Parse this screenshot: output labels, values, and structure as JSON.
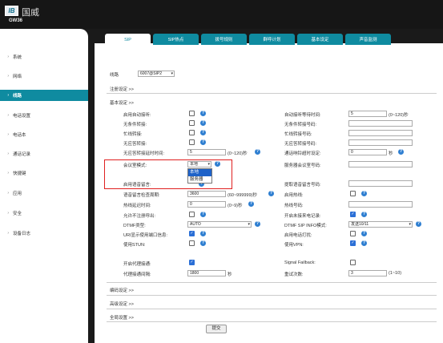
{
  "brand": {
    "logo_text": "IB",
    "name_cn": "国威",
    "model": "GW36"
  },
  "sidebar": {
    "items": [
      {
        "label": "系统"
      },
      {
        "label": "网络"
      },
      {
        "label": "线路"
      },
      {
        "label": "电话设置"
      },
      {
        "label": "电话本"
      },
      {
        "label": "通话记录"
      },
      {
        "label": "快捷键"
      },
      {
        "label": "应用"
      },
      {
        "label": "安全"
      },
      {
        "label": "设备日志"
      }
    ]
  },
  "tabs": [
    {
      "label": "SIP"
    },
    {
      "label": "SIP热点"
    },
    {
      "label": "拨号规则"
    },
    {
      "label": "群呼计划"
    },
    {
      "label": "基本设定"
    },
    {
      "label": "声音监测"
    }
  ],
  "line": {
    "label": "线路",
    "value": "6007@SIP2"
  },
  "sections": {
    "register": "注册设定 >>",
    "basic": "基本设定 >>",
    "codec": "编码设定 >>",
    "advanced": "高级设定 >>",
    "global": "全局设置 >>"
  },
  "fields": {
    "auto_answer": "启用自动接听:",
    "no_answer_fwd": "无条件转接:",
    "busy_fwd": "忙线转接:",
    "noanswer_fwd": "无应答转接:",
    "noanswer_fwd_time": "无应答转接延时时间:",
    "conf_mode": "会议室模式:",
    "voicemail": "启用语音留言:",
    "vm_check_interval": "语音留言检查周期:",
    "hotline_delay": "热线延迟时间:",
    "allow_unregistered": "允许不注册呼出:",
    "dtmf_type": "DTMF类型:",
    "uri_port": "URI显示使用端口信息:",
    "use_stun": "使用STUN:",
    "enable_proxy": "开启代理接通:",
    "proxy_interval": "代理接通间隔:",
    "auto_answer_wait": "自动接听等待时间:",
    "no_answer_fwd_num": "无条件转接号码:",
    "busy_fwd_num": "忙线转接号码:",
    "noanswer_fwd_num": "无应答转接号码:",
    "ring_timeout": "通话响铃超时设定:",
    "server_conf_num": "服务器会议室号码:",
    "vm_number": "提取语音留言号码:",
    "enable_hotline": "启用热线:",
    "hotline_num": "热线号码:",
    "enable_missed_log": "开启未接来电记录:",
    "dtmf_sip_info": "DTMF SIP INFO模式:",
    "enable_callpark": "启用电话打扰:",
    "use_vpn": "使用VPN:",
    "signal_failback": "Signal Failback:",
    "retry_count": "重试次数:"
  },
  "values": {
    "auto_answer_wait": "5",
    "auto_answer_wait_unit": "(0~120)秒",
    "noanswer_fwd_time": "5",
    "noanswer_fwd_time_unit": "(0~120)秒",
    "ring_timeout": "0",
    "ring_timeout_unit": "秒",
    "conf_mode": "本地",
    "vm_check_interval": "3600",
    "vm_check_interval_unit": "(60~999999)秒",
    "hotline_delay": "0",
    "hotline_delay_unit": "(0~9)秒",
    "dtmf_type": "AUTO",
    "dtmf_sip_info": "发送10/11",
    "proxy_interval": "1800",
    "proxy_interval_unit": "秒",
    "retry_count": "3",
    "retry_count_unit": "(1~10)"
  },
  "conf_mode_options": [
    "本地",
    "服务器"
  ],
  "submit_label": "提交",
  "colors": {
    "accent": "#0f8ba0",
    "highlight": "#e02020",
    "checkbox_on": "#2b6fd6"
  }
}
